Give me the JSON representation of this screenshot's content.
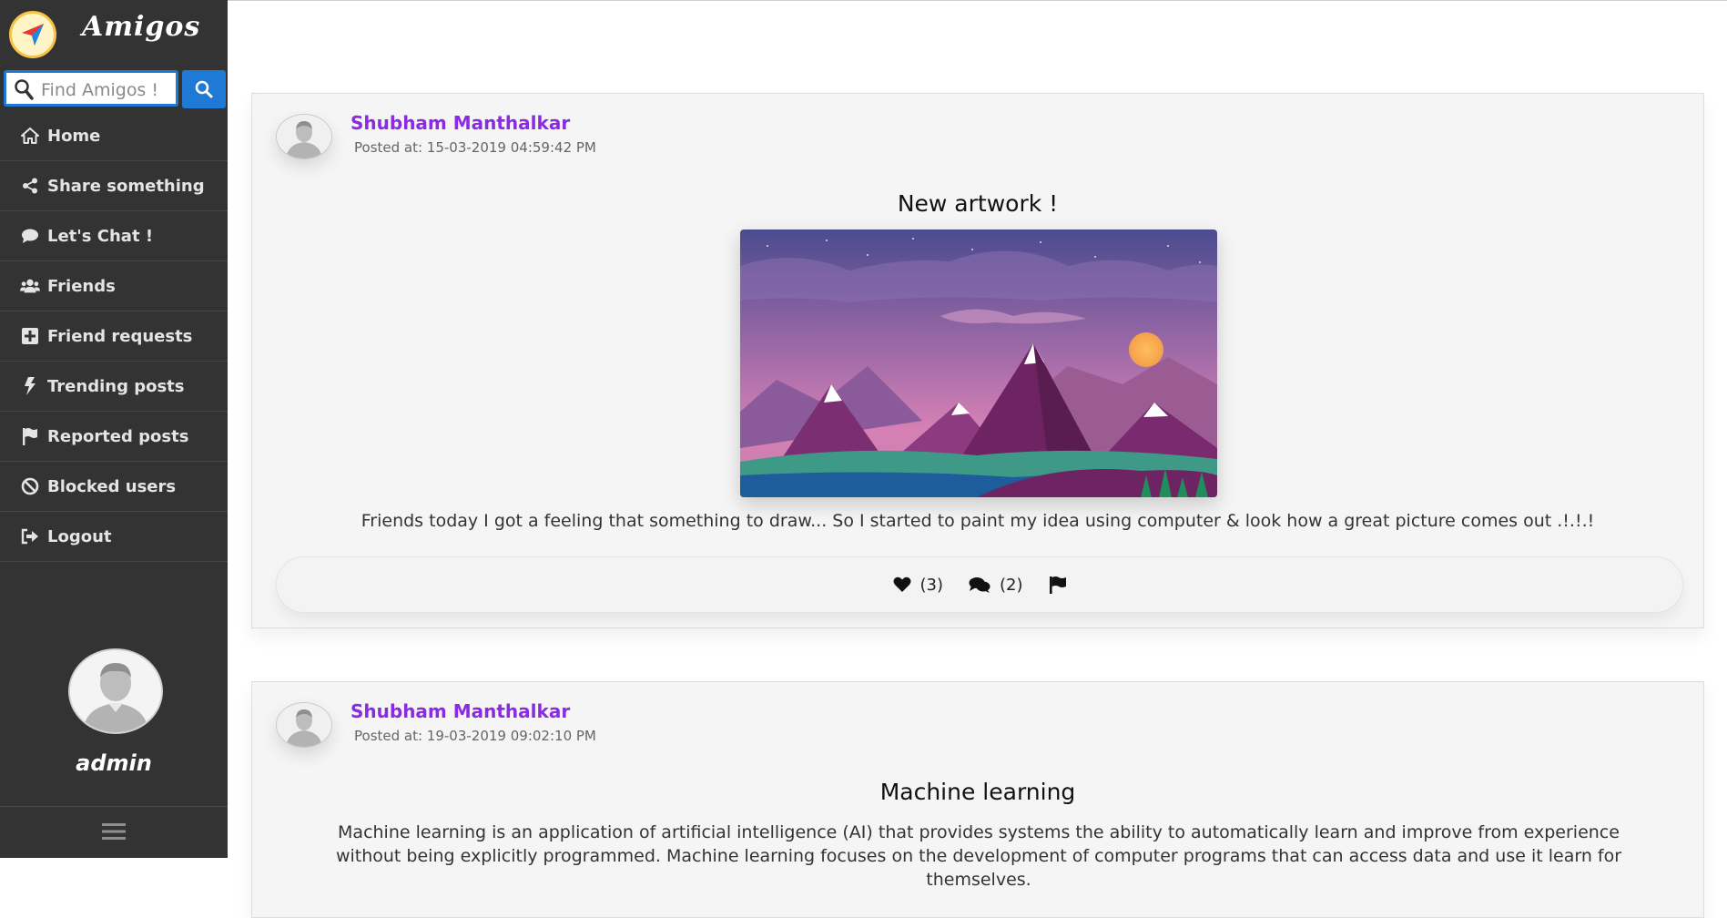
{
  "app": {
    "brand": "Amigos",
    "accent_color": "#1f7ad6",
    "author_color": "#8a2be2"
  },
  "search": {
    "placeholder": "Find Amigos !",
    "value": ""
  },
  "sidebar": {
    "items": [
      {
        "label": "Home",
        "icon": "home-icon"
      },
      {
        "label": "Share something",
        "icon": "share-icon"
      },
      {
        "label": "Let's Chat !",
        "icon": "chat-icon"
      },
      {
        "label": "Friends",
        "icon": "users-icon"
      },
      {
        "label": "Friend requests",
        "icon": "plus-square-icon"
      },
      {
        "label": "Trending posts",
        "icon": "bolt-icon"
      },
      {
        "label": "Reported posts",
        "icon": "flag-icon"
      },
      {
        "label": "Blocked users",
        "icon": "ban-icon"
      },
      {
        "label": "Logout",
        "icon": "sign-out-icon"
      }
    ]
  },
  "user": {
    "username": "admin"
  },
  "posts": [
    {
      "author": "Shubham Manthalkar",
      "posted": "Posted at: 15-03-2019 04:59:42 PM",
      "title": "New artwork !",
      "body": "Friends today I got a feeling that something to draw... So I started to paint my idea using computer & look how a great picture comes out .!.!.!",
      "likes": "(3)",
      "comments": "(2)"
    },
    {
      "author": "Shubham Manthalkar",
      "posted": "Posted at: 19-03-2019 09:02:10 PM",
      "title": "Machine learning",
      "body": "Machine learning is an application of artificial intelligence (AI) that provides systems the ability to automatically learn and improve from experience without being explicitly programmed. Machine learning focuses on the development of computer programs that can access data and use it learn for themselves."
    }
  ]
}
